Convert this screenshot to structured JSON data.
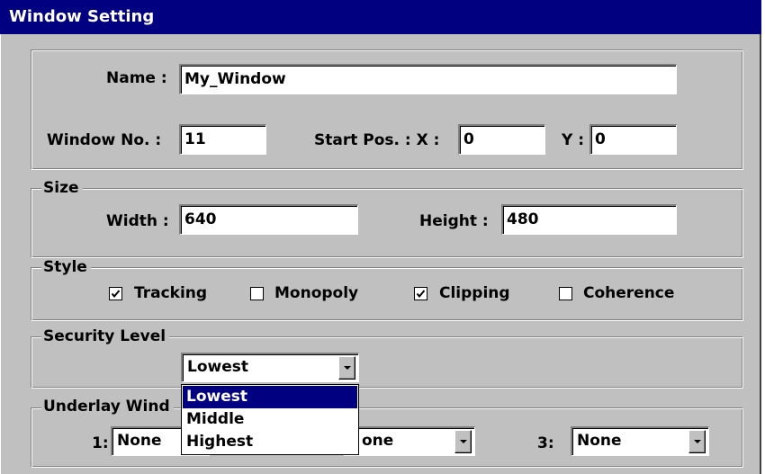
{
  "window": {
    "title": "Window Setting"
  },
  "general": {
    "name_label": "Name :",
    "name_value": "My_Window",
    "window_no_label": "Window No. :",
    "window_no_value": "11",
    "start_pos_label": "Start Pos. :  X :",
    "start_x_value": "0",
    "start_y_label": "Y :",
    "start_y_value": "0"
  },
  "size": {
    "legend": "Size",
    "width_label": "Width :",
    "width_value": "640",
    "height_label": "Height :",
    "height_value": "480"
  },
  "style": {
    "legend": "Style",
    "options": [
      {
        "label": "Tracking",
        "checked": true
      },
      {
        "label": "Monopoly",
        "checked": false
      },
      {
        "label": "Clipping",
        "checked": true
      },
      {
        "label": "Coherence",
        "checked": false
      }
    ]
  },
  "security": {
    "legend": "Security  Level",
    "selected": "Lowest",
    "options": [
      "Lowest",
      "Middle",
      "Highest"
    ],
    "highlighted": "Lowest"
  },
  "underlay": {
    "legend": "Underlay Wind",
    "slot1_label": "1:",
    "slot1_value": "None",
    "slot2_value": "one",
    "slot3_label": "3:",
    "slot3_value": "None"
  },
  "icons": {
    "checkbox_check": "check-mark-icon",
    "dropdown_arrow": "chevron-down-icon"
  }
}
